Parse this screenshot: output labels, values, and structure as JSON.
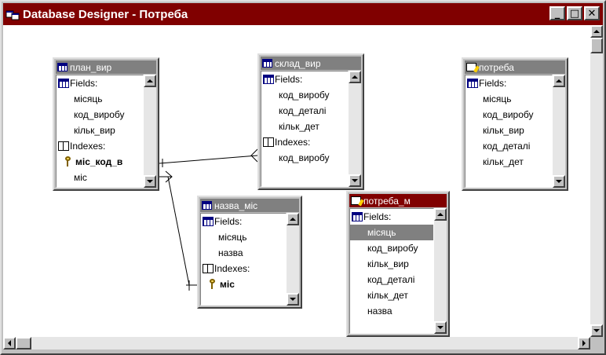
{
  "window": {
    "title": "Database Designer - Потреба",
    "minimize_glyph": "_",
    "maximize_glyph": "□",
    "close_glyph": "✕"
  },
  "tables": {
    "plan_vyr": {
      "title": "план_вир",
      "fields_label": "Fields:",
      "fields": [
        "місяць",
        "код_виробу",
        "кільк_вир"
      ],
      "indexes_label": "Indexes:",
      "indexes": [
        "міс_код_в",
        "міс"
      ]
    },
    "sklad_vyr": {
      "title": "склад_вир",
      "fields_label": "Fields:",
      "fields": [
        "код_виробу",
        "код_деталі",
        "кільк_дет"
      ],
      "indexes_label": "Indexes:",
      "indexes": [
        "код_виробу"
      ]
    },
    "potreba": {
      "title": "потреба",
      "fields_label": "Fields:",
      "fields": [
        "місяць",
        "код_виробу",
        "кільк_вир",
        "код_деталі",
        "кільк_дет"
      ]
    },
    "nazva_mis": {
      "title": "назва_міс",
      "fields_label": "Fields:",
      "fields": [
        "місяць",
        "назва"
      ],
      "indexes_label": "Indexes:",
      "indexes": [
        "міс"
      ]
    },
    "potreba_m": {
      "title": "потреба_м",
      "fields_label": "Fields:",
      "fields": [
        "місяць",
        "код_виробу",
        "кільк_вир",
        "код_деталі",
        "кільк_дет",
        "назва"
      ],
      "selected_field": "місяць"
    }
  },
  "colors": {
    "active_title": "#800000",
    "inactive_title": "#808080",
    "face": "#c0c0c0",
    "canvas": "#ffffff"
  }
}
